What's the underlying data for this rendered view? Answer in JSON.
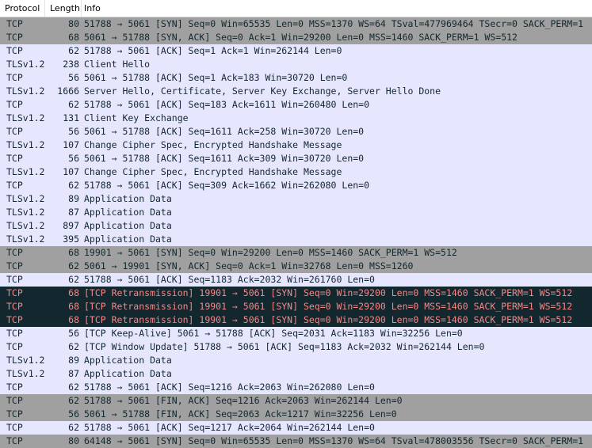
{
  "header": {
    "protocol": "Protocol",
    "length": "Length",
    "info": "Info"
  },
  "colors": {
    "syn_fin_gray": "#a0a0a0",
    "tcp_lavender": "#e7e6ff",
    "bad_tcp_bg": "#12272e",
    "bad_tcp_fg": "#f78787"
  },
  "packets": [
    {
      "protocol": "TCP",
      "length": "80",
      "info": "51788 → 5061 [SYN] Seq=0 Win=65535 Len=0 MSS=1370 WS=64 TSval=477969464 TSecr=0 SACK_PERM=1",
      "style": "tcp-syn"
    },
    {
      "protocol": "TCP",
      "length": "68",
      "info": "5061 → 51788 [SYN, ACK] Seq=0 Ack=1 Win=29200 Len=0 MSS=1460 SACK_PERM=1 WS=512",
      "style": "tcp-syn"
    },
    {
      "protocol": "TCP",
      "length": "62",
      "info": "51788 → 5061 [ACK] Seq=1 Ack=1 Win=262144 Len=0",
      "style": "tcp"
    },
    {
      "protocol": "TLSv1.2",
      "length": "238",
      "info": "Client Hello",
      "style": "tls"
    },
    {
      "protocol": "TCP",
      "length": "56",
      "info": "5061 → 51788 [ACK] Seq=1 Ack=183 Win=30720 Len=0",
      "style": "tcp"
    },
    {
      "protocol": "TLSv1.2",
      "length": "1666",
      "info": "Server Hello, Certificate, Server Key Exchange, Server Hello Done",
      "style": "tls"
    },
    {
      "protocol": "TCP",
      "length": "62",
      "info": "51788 → 5061 [ACK] Seq=183 Ack=1611 Win=260480 Len=0",
      "style": "tcp"
    },
    {
      "protocol": "TLSv1.2",
      "length": "131",
      "info": "Client Key Exchange",
      "style": "tls"
    },
    {
      "protocol": "TCP",
      "length": "56",
      "info": "5061 → 51788 [ACK] Seq=1611 Ack=258 Win=30720 Len=0",
      "style": "tcp"
    },
    {
      "protocol": "TLSv1.2",
      "length": "107",
      "info": "Change Cipher Spec, Encrypted Handshake Message",
      "style": "tls"
    },
    {
      "protocol": "TCP",
      "length": "56",
      "info": "5061 → 51788 [ACK] Seq=1611 Ack=309 Win=30720 Len=0",
      "style": "tcp"
    },
    {
      "protocol": "TLSv1.2",
      "length": "107",
      "info": "Change Cipher Spec, Encrypted Handshake Message",
      "style": "tls"
    },
    {
      "protocol": "TCP",
      "length": "62",
      "info": "51788 → 5061 [ACK] Seq=309 Ack=1662 Win=262080 Len=0",
      "style": "tcp"
    },
    {
      "protocol": "TLSv1.2",
      "length": "89",
      "info": "Application Data",
      "style": "tls"
    },
    {
      "protocol": "TLSv1.2",
      "length": "87",
      "info": "Application Data",
      "style": "tls"
    },
    {
      "protocol": "TLSv1.2",
      "length": "897",
      "info": "Application Data",
      "style": "tls"
    },
    {
      "protocol": "TLSv1.2",
      "length": "395",
      "info": "Application Data",
      "style": "tls"
    },
    {
      "protocol": "TCP",
      "length": "68",
      "info": "19901 → 5061 [SYN] Seq=0 Win=29200 Len=0 MSS=1460 SACK_PERM=1 WS=512",
      "style": "tcp-syn"
    },
    {
      "protocol": "TCP",
      "length": "62",
      "info": "5061 → 19901 [SYN, ACK] Seq=0 Ack=1 Win=32768 Len=0 MSS=1260",
      "style": "tcp-syn"
    },
    {
      "protocol": "TCP",
      "length": "62",
      "info": "51788 → 5061 [ACK] Seq=1183 Ack=2032 Win=261760 Len=0",
      "style": "tcp"
    },
    {
      "protocol": "TCP",
      "length": "68",
      "info": "[TCP Retransmission] 19901 → 5061 [SYN] Seq=0 Win=29200 Len=0 MSS=1460 SACK_PERM=1 WS=512",
      "style": "bad"
    },
    {
      "protocol": "TCP",
      "length": "68",
      "info": "[TCP Retransmission] 19901 → 5061 [SYN] Seq=0 Win=29200 Len=0 MSS=1460 SACK_PERM=1 WS=512",
      "style": "bad"
    },
    {
      "protocol": "TCP",
      "length": "68",
      "info": "[TCP Retransmission] 19901 → 5061 [SYN] Seq=0 Win=29200 Len=0 MSS=1460 SACK_PERM=1 WS=512",
      "style": "bad"
    },
    {
      "protocol": "TCP",
      "length": "56",
      "info": "[TCP Keep-Alive] 5061 → 51788 [ACK] Seq=2031 Ack=1183 Win=32256 Len=0",
      "style": "tcp"
    },
    {
      "protocol": "TCP",
      "length": "62",
      "info": "[TCP Window Update] 51788 → 5061 [ACK] Seq=1183 Ack=2032 Win=262144 Len=0",
      "style": "tcp"
    },
    {
      "protocol": "TLSv1.2",
      "length": "89",
      "info": "Application Data",
      "style": "tls"
    },
    {
      "protocol": "TLSv1.2",
      "length": "87",
      "info": "Application Data",
      "style": "tls"
    },
    {
      "protocol": "TCP",
      "length": "62",
      "info": "51788 → 5061 [ACK] Seq=1216 Ack=2063 Win=262080 Len=0",
      "style": "tcp"
    },
    {
      "protocol": "TCP",
      "length": "62",
      "info": "51788 → 5061 [FIN, ACK] Seq=1216 Ack=2063 Win=262144 Len=0",
      "style": "tcp-syn"
    },
    {
      "protocol": "TCP",
      "length": "56",
      "info": "5061 → 51788 [FIN, ACK] Seq=2063 Ack=1217 Win=32256 Len=0",
      "style": "tcp-syn"
    },
    {
      "protocol": "TCP",
      "length": "62",
      "info": "51788 → 5061 [ACK] Seq=1217 Ack=2064 Win=262144 Len=0",
      "style": "tcp"
    },
    {
      "protocol": "TCP",
      "length": "80",
      "info": "64148 → 5061 [SYN] Seq=0 Win=65535 Len=0 MSS=1370 WS=64 TSval=478003556 TSecr=0 SACK_PERM=1",
      "style": "tcp-syn"
    }
  ]
}
